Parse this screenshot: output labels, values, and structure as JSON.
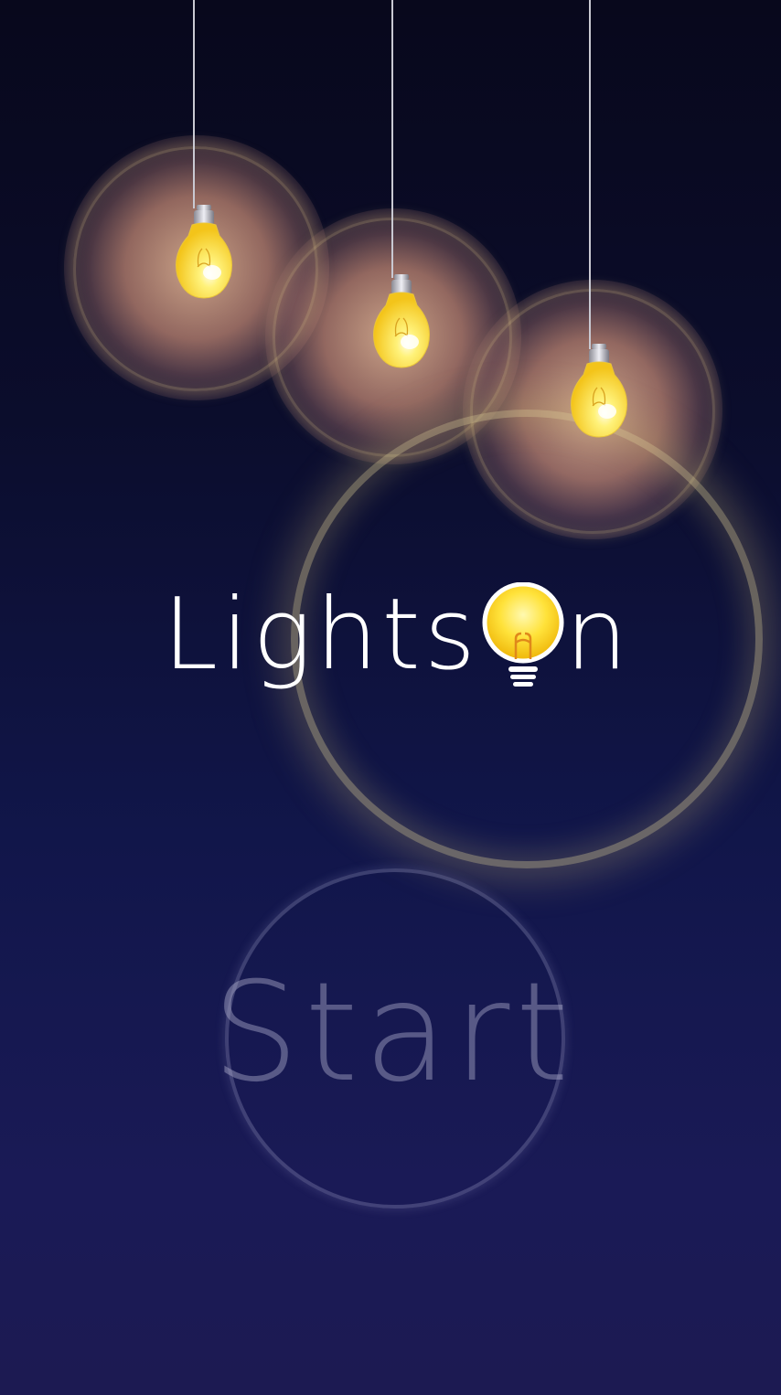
{
  "game": {
    "title_left": "Lights",
    "title_right": "n",
    "start_label": "Start",
    "bulb_count": 3,
    "colors": {
      "background_top": "#08081c",
      "background_bottom": "#1c1a52",
      "bulb_yellow": "#ffe24a",
      "glow": "#f0b08a",
      "ring": "#d8c88c"
    },
    "icons": [
      "hanging-lightbulb-icon",
      "title-lightbulb-icon"
    ]
  }
}
